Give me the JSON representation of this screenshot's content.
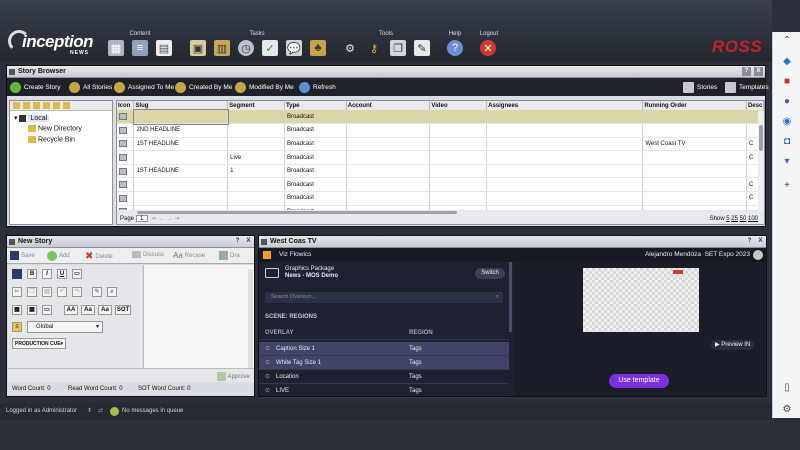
{
  "header": {
    "logo_text": "inception",
    "logo_sub": "NEWS",
    "brand": "ROSS",
    "groups": [
      {
        "label": "Content"
      },
      {
        "label": "Tasks"
      },
      {
        "label": "Tools"
      },
      {
        "label": "Help"
      },
      {
        "label": "Logout"
      }
    ]
  },
  "story_browser": {
    "title": "Story Browser",
    "toolbar": [
      "Create Story",
      "All Stories",
      "Assigned To Me",
      "Created By Me",
      "Modified By Me",
      "Refresh"
    ],
    "right_tabs": [
      "Stories",
      "Templates"
    ],
    "tree": [
      "Local",
      "New Directory",
      "Recycle Bin"
    ],
    "columns": [
      "Icon",
      "Slug",
      "Segment",
      "Type",
      "Account",
      "Video",
      "Assignees",
      "Running Order",
      "Desc"
    ],
    "rows": [
      {
        "slug": "",
        "segment": "",
        "type": "Broadcast",
        "running_order": "",
        "desc": "",
        "selected": true
      },
      {
        "slug": "2ND HEADLINE",
        "segment": "",
        "type": "Broadcast",
        "running_order": "",
        "desc": ""
      },
      {
        "slug": "1ST HEADLINE",
        "segment": "",
        "type": "Broadcast",
        "running_order": "West Coast TV",
        "desc": "C"
      },
      {
        "slug": "",
        "segment": "Live",
        "type": "Broadcast",
        "running_order": "",
        "desc": "C"
      },
      {
        "slug": "1ST HEADLINE",
        "segment": "1",
        "type": "Broadcast",
        "running_order": "",
        "desc": ""
      },
      {
        "slug": "",
        "segment": "",
        "type": "Broadcast",
        "running_order": "",
        "desc": "C"
      },
      {
        "slug": "",
        "segment": "",
        "type": "Broadcast",
        "running_order": "",
        "desc": "C"
      },
      {
        "slug": "",
        "segment": "",
        "type": "Broadcast",
        "running_order": "",
        "desc": ""
      }
    ],
    "page_label": "Page",
    "page_value": "1",
    "show_label": "Show",
    "show_options": [
      "5",
      "25",
      "50",
      "100"
    ]
  },
  "new_story": {
    "title": "New Story",
    "toolbar": [
      "Save",
      "Add",
      "Delete",
      "Discuss",
      "Recase",
      "Dra"
    ],
    "style_select": "Global",
    "production_cue": "PRODUCTION CUE",
    "approve": "Approve",
    "word_count": "Word Count: 0",
    "read_word_count": "Read Word Count: 0",
    "sot_word_count": "SOT Word Count: 0",
    "format_labels": [
      "B",
      "I",
      "U",
      "AA",
      "Aa",
      "Aa",
      "SOT"
    ]
  },
  "west_coast": {
    "title": "West Coas TV",
    "viz_title": "Viz Flowics",
    "user": "Alejandro Mendoza",
    "event": "SET Expo 2023",
    "package_name": "Graphics Package",
    "package_sub": "News - MOS Demo",
    "switch_label": "Switch",
    "search_placeholder": "Search Overlays...",
    "scene_label": "SCENE: REGIONS",
    "col_overlay": "OVERLAY",
    "col_region": "REGION",
    "overlays": [
      {
        "name": "Caption Size 1",
        "region": "Tags",
        "highlight": true
      },
      {
        "name": "White Tag Size 1",
        "region": "Tags",
        "highlight": true
      },
      {
        "name": "Location",
        "region": "Tags",
        "highlight": false
      },
      {
        "name": "LIVE",
        "region": "Tags",
        "highlight": false
      }
    ],
    "preview_label": "Preview IN",
    "use_template": "Use template"
  },
  "status": {
    "logged_in": "Logged in as Administrator",
    "messages": "No messages in queue"
  },
  "colors": {
    "accent_purple": "#7b2fe0",
    "ross_red": "#c8202a",
    "row_selected": "#d8d7a5"
  }
}
